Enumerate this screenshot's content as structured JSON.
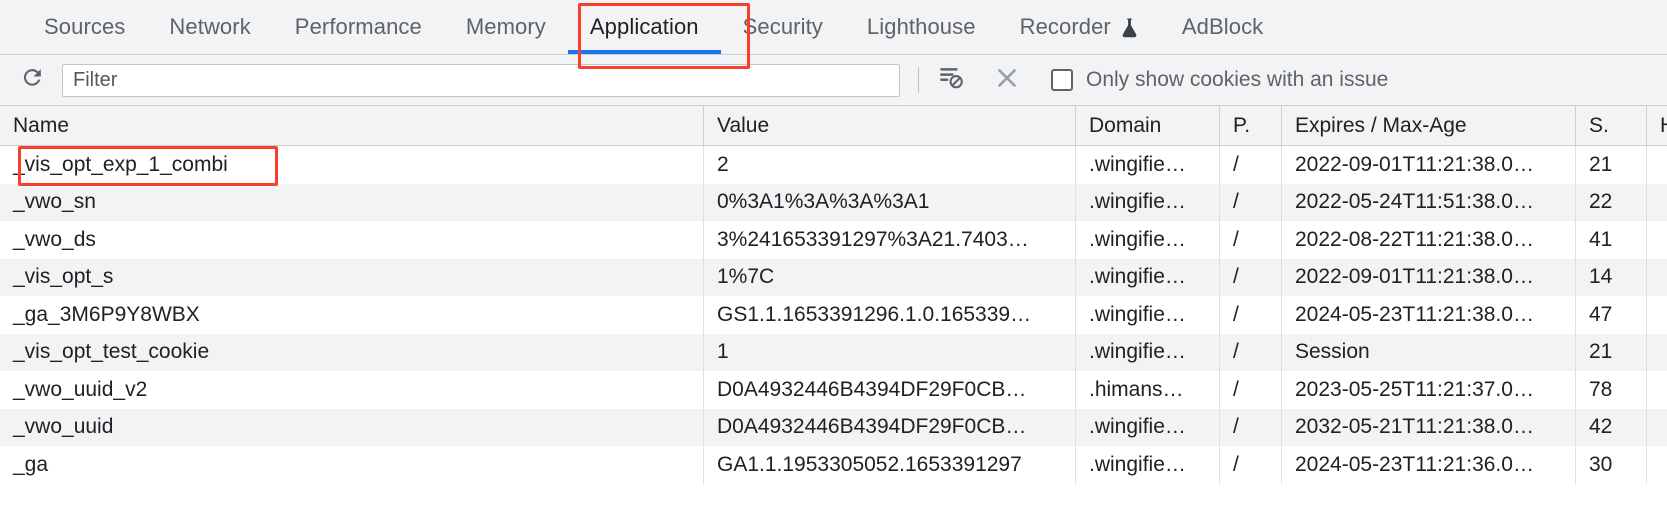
{
  "tabs": [
    {
      "label": "Sources",
      "active": false,
      "icon": null
    },
    {
      "label": "Network",
      "active": false,
      "icon": null
    },
    {
      "label": "Performance",
      "active": false,
      "icon": null
    },
    {
      "label": "Memory",
      "active": false,
      "icon": null
    },
    {
      "label": "Application",
      "active": true,
      "icon": null
    },
    {
      "label": "Security",
      "active": false,
      "icon": null
    },
    {
      "label": "Lighthouse",
      "active": false,
      "icon": null
    },
    {
      "label": "Recorder",
      "active": false,
      "icon": "flask-icon"
    },
    {
      "label": "AdBlock",
      "active": false,
      "icon": null
    }
  ],
  "toolbar": {
    "refresh_icon": "refresh-icon",
    "filter_placeholder": "Filter",
    "filter_value": "",
    "clear_filter_icon": "clear-filter-icon",
    "clear_icon": "close-x-icon",
    "issues_checkbox_label": "Only show cookies with an issue",
    "issues_checkbox_checked": false
  },
  "table": {
    "columns": [
      {
        "key": "name",
        "label": "Name"
      },
      {
        "key": "value",
        "label": "Value"
      },
      {
        "key": "domain",
        "label": "Domain"
      },
      {
        "key": "path",
        "label": "P."
      },
      {
        "key": "expires",
        "label": "Expires / Max-Age"
      },
      {
        "key": "size",
        "label": "S."
      },
      {
        "key": "http",
        "label": "H"
      }
    ],
    "rows": [
      {
        "name": "_vis_opt_exp_1_combi",
        "value": "2",
        "domain": ".wingifie…",
        "path": "/",
        "expires": "2022-09-01T11:21:38.0…",
        "size": "21",
        "http": ""
      },
      {
        "name": "_vwo_sn",
        "value": "0%3A1%3A%3A%3A1",
        "domain": ".wingifie…",
        "path": "/",
        "expires": "2022-05-24T11:51:38.0…",
        "size": "22",
        "http": ""
      },
      {
        "name": "_vwo_ds",
        "value": "3%241653391297%3A21.7403…",
        "domain": ".wingifie…",
        "path": "/",
        "expires": "2022-08-22T11:21:38.0…",
        "size": "41",
        "http": ""
      },
      {
        "name": "_vis_opt_s",
        "value": "1%7C",
        "domain": ".wingifie…",
        "path": "/",
        "expires": "2022-09-01T11:21:38.0…",
        "size": "14",
        "http": ""
      },
      {
        "name": "_ga_3M6P9Y8WBX",
        "value": "GS1.1.1653391296.1.0.165339…",
        "domain": ".wingifie…",
        "path": "/",
        "expires": "2024-05-23T11:21:38.0…",
        "size": "47",
        "http": ""
      },
      {
        "name": "_vis_opt_test_cookie",
        "value": "1",
        "domain": ".wingifie…",
        "path": "/",
        "expires": "Session",
        "size": "21",
        "http": ""
      },
      {
        "name": "_vwo_uuid_v2",
        "value": "D0A4932446B4394DF29F0CB…",
        "domain": ".himans…",
        "path": "/",
        "expires": "2023-05-25T11:21:37.0…",
        "size": "78",
        "http": ""
      },
      {
        "name": "_vwo_uuid",
        "value": "D0A4932446B4394DF29F0CB…",
        "domain": ".wingifie…",
        "path": "/",
        "expires": "2032-05-21T11:21:38.0…",
        "size": "42",
        "http": ""
      },
      {
        "name": "_ga",
        "value": "GA1.1.1953305052.1653391297",
        "domain": ".wingifie…",
        "path": "/",
        "expires": "2024-05-23T11:21:36.0…",
        "size": "30",
        "http": ""
      }
    ]
  },
  "annotations": {
    "color": "#f4402c",
    "highlighted_tab": "Application",
    "highlighted_cookie": "_vis_opt_exp_1_combi"
  }
}
